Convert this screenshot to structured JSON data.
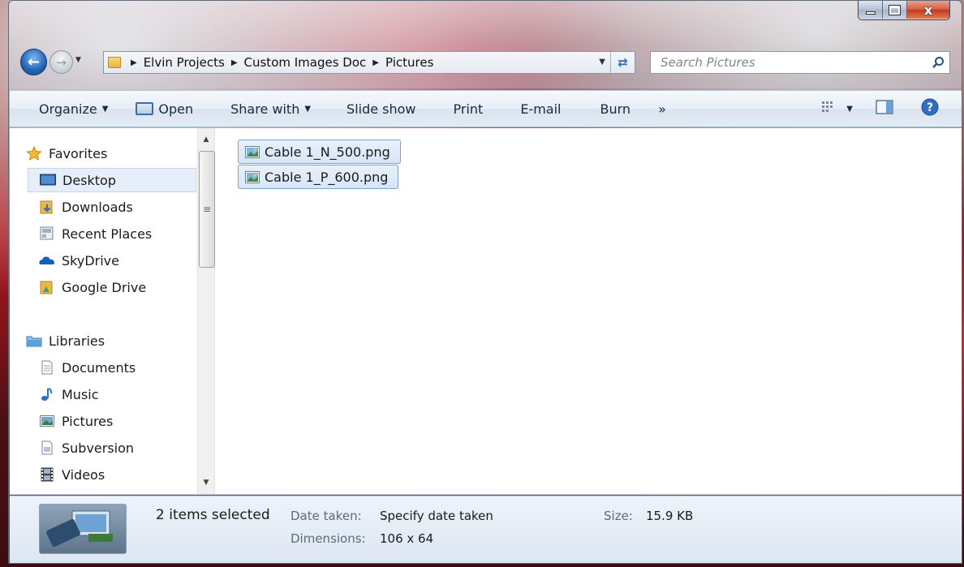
{
  "window": {
    "caption_buttons": [
      "minimize",
      "maximize",
      "close"
    ]
  },
  "nav": {
    "breadcrumbs": [
      "Elvin Projects",
      "Custom Images Doc",
      "Pictures"
    ],
    "search_placeholder": "Search Pictures"
  },
  "toolbar": {
    "organize": "Organize",
    "open": "Open",
    "share_with": "Share with",
    "slide_show": "Slide show",
    "print": "Print",
    "email": "E-mail",
    "burn": "Burn",
    "more": "»"
  },
  "sidebar": {
    "favorites": {
      "label": "Favorites",
      "items": [
        "Desktop",
        "Downloads",
        "Recent Places",
        "SkyDrive",
        "Google Drive"
      ]
    },
    "libraries": {
      "label": "Libraries",
      "items": [
        "Documents",
        "Music",
        "Pictures",
        "Subversion",
        "Videos"
      ]
    },
    "selected": "Desktop"
  },
  "files": [
    {
      "name": "Cable 1_N_500.png",
      "selected": true
    },
    {
      "name": "Cable 1_P_600.png",
      "selected": true
    }
  ],
  "details": {
    "count": "2 items selected",
    "date_taken_label": "Date taken:",
    "date_taken_value": "Specify date taken",
    "size_label": "Size:",
    "size_value": "15.9 KB",
    "dimensions_label": "Dimensions:",
    "dimensions_value": "106 x 64"
  },
  "colors": {
    "selection": "#d6e6f8",
    "selection_border": "#7da2ce",
    "toolbar_bg": "#e8eef6",
    "accent": "#1f63b5"
  }
}
